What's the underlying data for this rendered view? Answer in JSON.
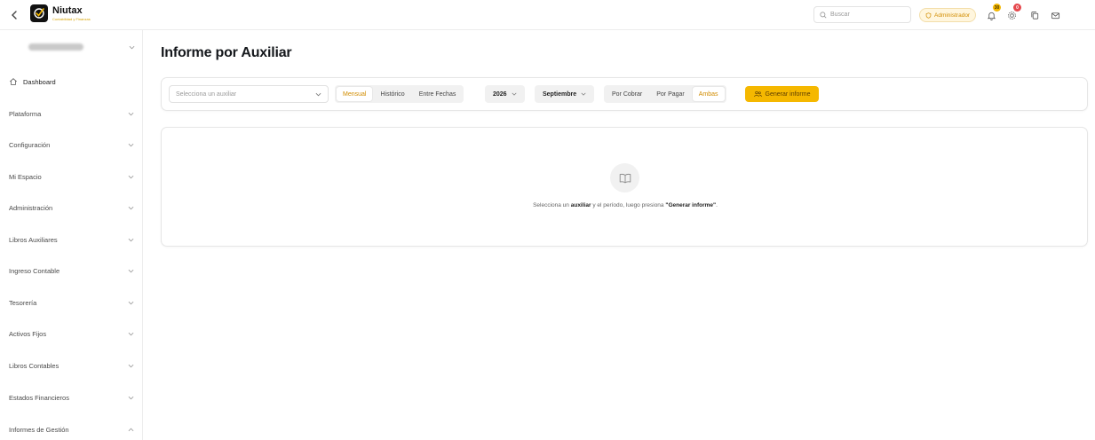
{
  "brand": {
    "name": "Niutax",
    "tagline": "Contabilidad y Finanzas"
  },
  "topbar": {
    "search_placeholder": "Buscar",
    "role_badge": "Administrador",
    "notifications_count": "30",
    "settings_count": "0"
  },
  "sidebar": {
    "dashboard": "Dashboard",
    "items": [
      {
        "label": "Plataforma"
      },
      {
        "label": "Configuración"
      },
      {
        "label": "Mi Espacio"
      },
      {
        "label": "Administración"
      },
      {
        "label": "Libros Auxiliares"
      },
      {
        "label": "Ingreso Contable"
      },
      {
        "label": "Tesorería"
      },
      {
        "label": "Activos Fijos"
      },
      {
        "label": "Libros Contables"
      },
      {
        "label": "Estados Financieros"
      },
      {
        "label": "Informes de Gestión"
      }
    ]
  },
  "page": {
    "title": "Informe por Auxiliar"
  },
  "filters": {
    "auxiliar_placeholder": "Selecciona un auxiliar",
    "period_modes": [
      "Mensual",
      "Histórico",
      "Entre Fechas"
    ],
    "active_period_mode": "Mensual",
    "year": "2026",
    "month": "Septiembre",
    "types": [
      "Por Cobrar",
      "Por Pagar",
      "Ambas"
    ],
    "active_type": "Ambas",
    "generate_label": "Generar informe"
  },
  "empty_state": {
    "text_1": "Selecciona un",
    "bold_1": "auxiliar",
    "text_2": "y el período, luego presiona",
    "bold_2": "\"Generar informe\"",
    "text_3": "."
  },
  "colors": {
    "accent": "#f5b800",
    "accent_text": "#d18c00",
    "badge_red": "#e5484d"
  },
  "icons": [
    "chevron-left-icon",
    "niutax-logo-icon",
    "search-icon",
    "shield-icon",
    "bell-icon",
    "gear-icon",
    "copy-icon",
    "mail-icon",
    "home-icon",
    "chevron-down-icon",
    "chevron-up-icon",
    "users-icon",
    "book-open-icon"
  ]
}
